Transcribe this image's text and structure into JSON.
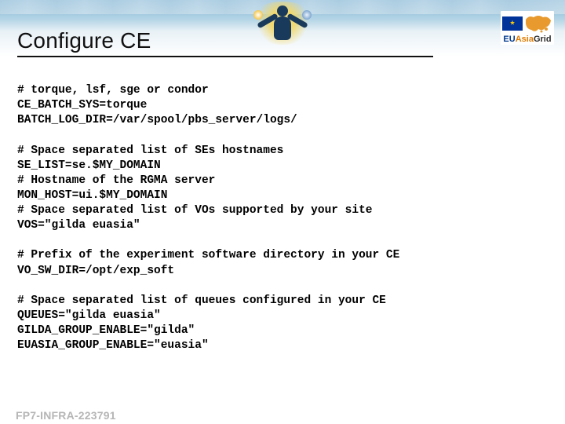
{
  "header": {
    "title": "Configure CE",
    "logo": {
      "text_eu": "EU",
      "text_asia": "Asia",
      "text_grid": "Grid"
    }
  },
  "config": {
    "block1": "# torque, lsf, sge or condor\nCE_BATCH_SYS=torque\nBATCH_LOG_DIR=/var/spool/pbs_server/logs/",
    "block2": "# Space separated list of SEs hostnames\nSE_LIST=se.$MY_DOMAIN\n# Hostname of the RGMA server\nMON_HOST=ui.$MY_DOMAIN\n# Space separated list of VOs supported by your site\nVOS=\"gilda euasia\"",
    "block3": "# Prefix of the experiment software directory in your CE\nVO_SW_DIR=/opt/exp_soft",
    "block4": "# Space separated list of queues configured in your CE\nQUEUES=\"gilda euasia\"\nGILDA_GROUP_ENABLE=\"gilda\"\nEUASIA_GROUP_ENABLE=\"euasia\""
  },
  "footer": {
    "text": "FP7-INFRA-223791"
  }
}
